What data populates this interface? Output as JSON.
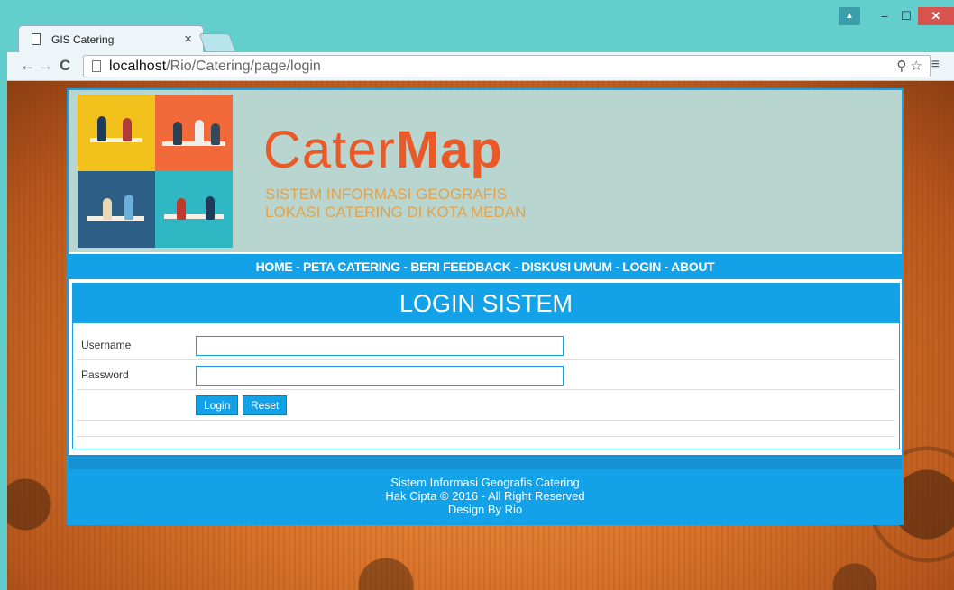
{
  "browser": {
    "tab_title": "GIS Catering",
    "tab_close": "×",
    "url_host": "localhost",
    "url_path": "/Rio/Catering/page/login",
    "window_controls": {
      "minimize": "–",
      "maximize": "☐",
      "close": "✕"
    }
  },
  "header": {
    "brand_light": "Cater",
    "brand_bold": "Map",
    "tagline_line1": "SISTEM INFORMASI GEOGRAFIS",
    "tagline_line2": "LOKASI CATERING DI KOTA MEDAN"
  },
  "nav": {
    "items": [
      "HOME",
      "PETA CATERING",
      "BERI FEEDBACK",
      "DISKUSI UMUM",
      "LOGIN",
      "ABOUT"
    ],
    "separator": " - "
  },
  "login": {
    "title": "LOGIN SISTEM",
    "username_label": "Username",
    "username_value": "",
    "password_label": "Password",
    "password_value": "",
    "login_button": "Login",
    "reset_button": "Reset"
  },
  "footer": {
    "line1": "Sistem Informasi Geografis Catering",
    "line2": "Hak Cipta © 2016 - All Right Reserved",
    "line3": "Design By Rio"
  },
  "colors": {
    "accent": "#13a2e8",
    "brand": "#ea5a28",
    "tagline": "#e3a24a",
    "header_bg": "#b8d6cf"
  },
  "icons": [
    "page-icon",
    "back-arrow-icon",
    "forward-arrow-icon",
    "reload-icon",
    "zoom-icon",
    "star-icon",
    "menu-icon",
    "user-icon"
  ]
}
